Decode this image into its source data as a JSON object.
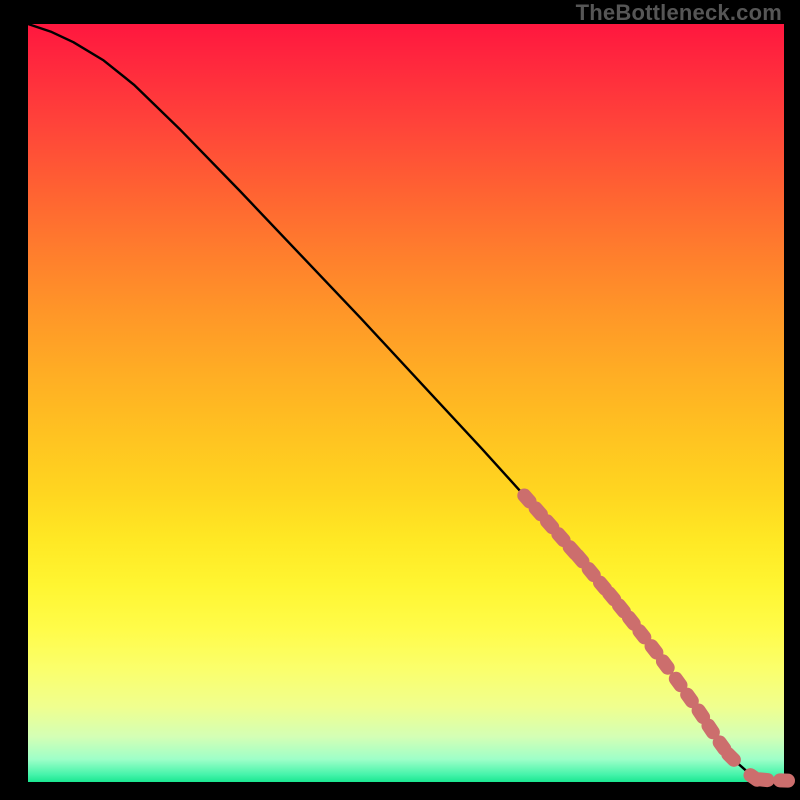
{
  "watermark": "TheBottleneck.com",
  "colors": {
    "background": "#000000",
    "line": "#000000",
    "marker": "#cc6e6d",
    "watermark": "#565656"
  },
  "chart_data": {
    "type": "line",
    "title": "",
    "xlabel": "",
    "ylabel": "",
    "xlim": [
      0,
      100
    ],
    "ylim": [
      0,
      100
    ],
    "grid": false,
    "series": [
      {
        "name": "curve",
        "x": [
          0,
          3,
          6,
          10,
          14,
          20,
          28,
          36,
          44,
          52,
          60,
          66,
          70,
          74,
          78,
          82,
          85,
          88,
          91,
          93.5,
          96,
          98,
          100
        ],
        "y": [
          100,
          99,
          97.6,
          95.2,
          92,
          86.2,
          78,
          69.6,
          61.2,
          52.6,
          44,
          37.4,
          33,
          28.4,
          23.6,
          18.6,
          14.6,
          10.4,
          6.0,
          2.8,
          0.6,
          0.2,
          0.2
        ]
      }
    ],
    "markers": [
      {
        "x": 66.0,
        "y": 37.4
      },
      {
        "x": 67.5,
        "y": 35.7
      },
      {
        "x": 69.0,
        "y": 34.0
      },
      {
        "x": 70.5,
        "y": 32.3
      },
      {
        "x": 72.0,
        "y": 30.6
      },
      {
        "x": 73.0,
        "y": 29.5
      },
      {
        "x": 74.5,
        "y": 27.7
      },
      {
        "x": 76.0,
        "y": 25.9
      },
      {
        "x": 77.2,
        "y": 24.5
      },
      {
        "x": 78.5,
        "y": 22.9
      },
      {
        "x": 79.8,
        "y": 21.3
      },
      {
        "x": 81.2,
        "y": 19.5
      },
      {
        "x": 82.8,
        "y": 17.5
      },
      {
        "x": 84.3,
        "y": 15.5
      },
      {
        "x": 86.0,
        "y": 13.2
      },
      {
        "x": 87.5,
        "y": 11.1
      },
      {
        "x": 89.0,
        "y": 9.0
      },
      {
        "x": 90.3,
        "y": 7.0
      },
      {
        "x": 91.8,
        "y": 4.8
      },
      {
        "x": 93.0,
        "y": 3.3
      },
      {
        "x": 96.0,
        "y": 0.6
      },
      {
        "x": 97.3,
        "y": 0.3
      },
      {
        "x": 100.0,
        "y": 0.2
      }
    ]
  }
}
